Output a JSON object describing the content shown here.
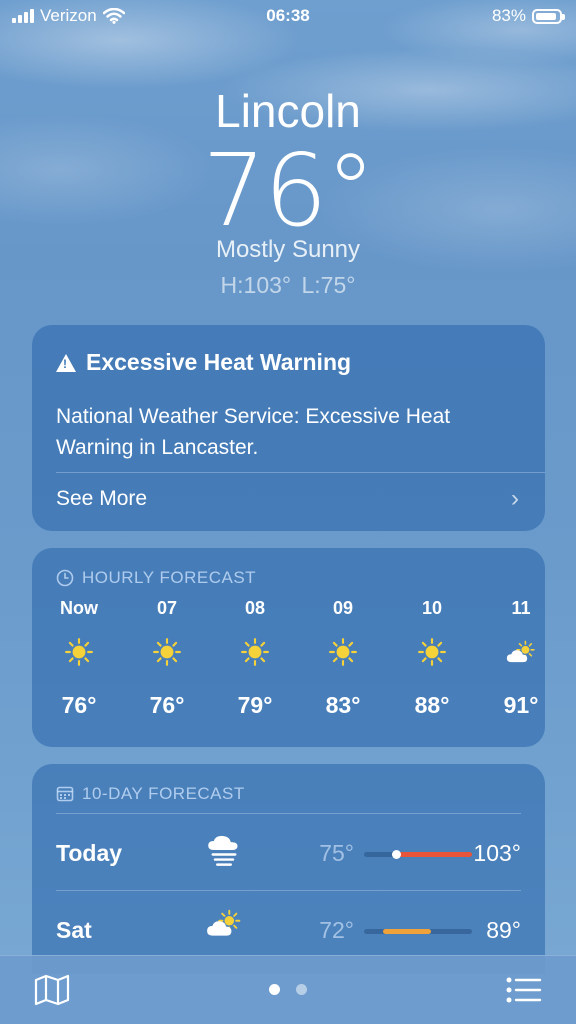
{
  "status_bar": {
    "carrier": "Verizon",
    "time": "06:38",
    "battery": "83%"
  },
  "location": {
    "city": "Lincoln",
    "temperature": "76°",
    "condition": "Mostly Sunny",
    "high_low": "H:103°  L:75°"
  },
  "alert": {
    "title": "Excessive Heat Warning",
    "body": "National Weather Service: Excessive Heat Warning in Lancaster.",
    "link": "See More"
  },
  "hourly": {
    "header": "HOURLY FORECAST",
    "hours": [
      {
        "label": "Now",
        "icon": "sun-icon",
        "temp": "76°"
      },
      {
        "label": "07",
        "icon": "sun-icon",
        "temp": "76°"
      },
      {
        "label": "08",
        "icon": "sun-icon",
        "temp": "79°"
      },
      {
        "label": "09",
        "icon": "sun-icon",
        "temp": "83°"
      },
      {
        "label": "10",
        "icon": "sun-icon",
        "temp": "88°"
      },
      {
        "label": "11",
        "icon": "partly-cloudy-icon",
        "temp": "91°"
      }
    ]
  },
  "daily": {
    "header": "10-DAY FORECAST",
    "days": [
      {
        "name": "Today",
        "icon": "fog-icon",
        "low": "75°",
        "high": "103°",
        "range_start": 0.3,
        "range_end": 1.0,
        "current": 0.3,
        "range_color": "#e8553a"
      },
      {
        "name": "Sat",
        "icon": "partly-cloudy-icon",
        "low": "72°",
        "high": "89°",
        "range_start": 0.18,
        "range_end": 0.62,
        "range_color": "#f0a23a"
      }
    ]
  },
  "colors": {
    "accent": "#ffffff",
    "sun": "#f5d13a",
    "heat_bar": "#e8553a"
  },
  "page_indicator": {
    "pages": 2,
    "current": 0
  }
}
